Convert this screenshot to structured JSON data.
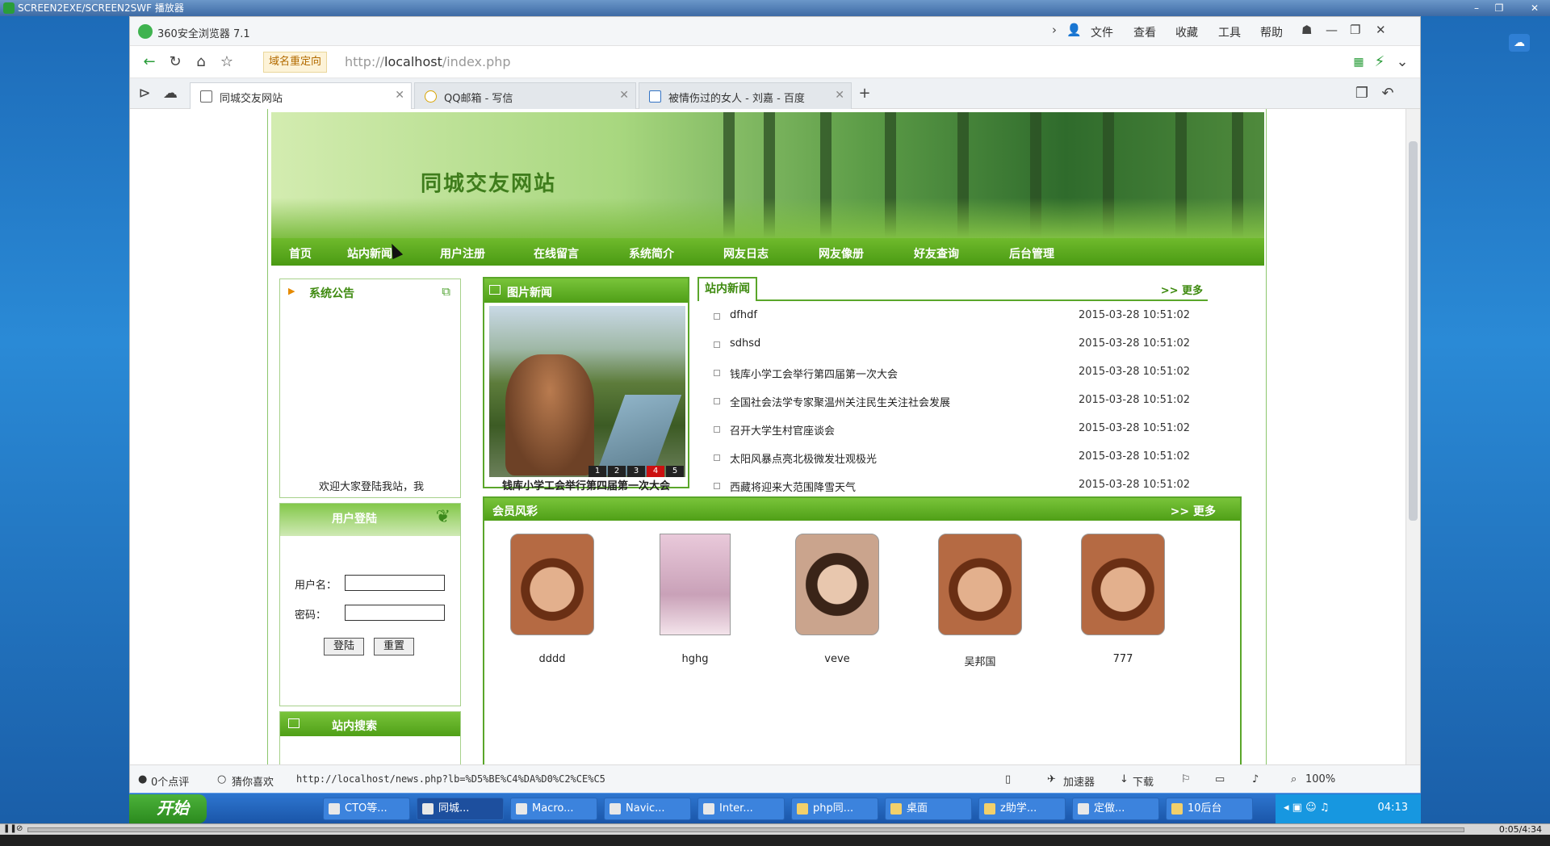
{
  "player": {
    "title": "SCREEN2EXE/SCREEN2SWF 播放器",
    "time": "0:05/4:34",
    "controls": {
      "minimize": "–",
      "restore": "❐",
      "close": "✕"
    }
  },
  "browser": {
    "name": "360安全浏览器 7.1",
    "menu": [
      "文件",
      "查看",
      "收藏",
      "工具",
      "帮助"
    ],
    "window_controls": {
      "pin": "☗",
      "minimize": "—",
      "restore": "❐",
      "close": "✕"
    },
    "redirect_label": "域名重定向",
    "url_prefix": "http://",
    "url_host": "localhost",
    "url_path": "/index.php",
    "tabs": [
      {
        "title": "同城交友网站",
        "active": true
      },
      {
        "title": "QQ邮箱 - 写信",
        "active": false
      },
      {
        "title": "被情伤过的女人 - 刘嘉 - 百度",
        "active": false
      }
    ],
    "new_tab": "+"
  },
  "site": {
    "title": "同城交友网站",
    "nav": [
      "首页",
      "站内新闻",
      "用户注册",
      "在线留言",
      "系统简介",
      "网友日志",
      "网友像册",
      "好友查询",
      "后台管理"
    ],
    "announcement": {
      "heading": "系统公告",
      "text": "欢迎大家登陆我站，我"
    },
    "login": {
      "heading": "用户登陆",
      "username_label": "用户名：",
      "password_label": "密码：",
      "login_button": "登陆",
      "reset_button": "重置"
    },
    "search_heading": "站内搜索",
    "photo_news": {
      "heading": "图片新闻",
      "caption": "钱库小学工会举行第四届第一次大会",
      "pages": [
        "1",
        "2",
        "3",
        "4",
        "5"
      ],
      "current_page": "4"
    },
    "news": {
      "heading": "站内新闻",
      "more": ">> 更多",
      "items": [
        {
          "title": "dfhdf",
          "date": "2015-03-28 10:51:02"
        },
        {
          "title": "sdhsd",
          "date": "2015-03-28 10:51:02"
        },
        {
          "title": "钱库小学工会举行第四届第一次大会",
          "date": "2015-03-28 10:51:02"
        },
        {
          "title": "全国社会法学专家聚温州关注民生关注社会发展",
          "date": "2015-03-28 10:51:02"
        },
        {
          "title": "召开大学生村官座谈会",
          "date": "2015-03-28 10:51:02"
        },
        {
          "title": "太阳风暴点亮北极微发壮观极光",
          "date": "2015-03-28 10:51:02"
        },
        {
          "title": "西藏将迎来大范围降雪天气",
          "date": "2015-03-28 10:51:02"
        }
      ]
    },
    "members": {
      "heading": "会员风彩",
      "more": ">> 更多",
      "list": [
        {
          "name": "dddd",
          "color": "#b56a43"
        },
        {
          "name": "hghg",
          "color": "#d9b7c8"
        },
        {
          "name": "veve",
          "color": "#caa48d"
        },
        {
          "name": "吴邦国",
          "color": "#b56a43"
        },
        {
          "name": "777",
          "color": "#b56a43"
        }
      ]
    }
  },
  "statusbar": {
    "comments": "0个点评",
    "guess": "猜你喜欢",
    "link": "http://localhost/news.php?lb=%D5%BE%C4%DA%D0%C2%CE%C5",
    "accelerator": "加速器",
    "download": "下载",
    "zoom": "100%"
  },
  "taskbar": {
    "start": "开始",
    "tasks": [
      "CTO等...",
      "同城...",
      "Macro...",
      "Navic...",
      "Inter...",
      "php同...",
      "桌面",
      "z助学...",
      "定做...",
      "10后台"
    ],
    "clock": "04:13"
  }
}
